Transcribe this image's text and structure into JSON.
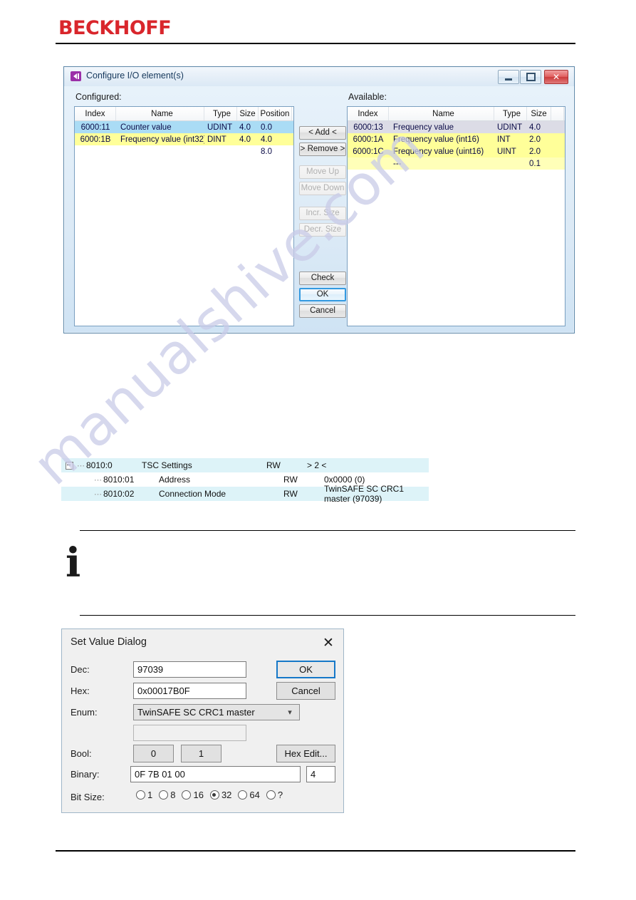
{
  "page": {
    "brand": "BECKHOFF",
    "watermark": "manualshive.com"
  },
  "io_dialog": {
    "title": "Configure I/O element(s)",
    "title_icon": "configure-io-icon",
    "window_buttons": {
      "minimize": "minimize-icon",
      "maximize": "maximize-icon",
      "close": "✕"
    },
    "configured": {
      "label": "Configured:",
      "columns": [
        "Index",
        "Name",
        "Type",
        "Size",
        "Position"
      ],
      "rows": [
        {
          "index": "6000:11",
          "name": "Counter value",
          "type": "UDINT",
          "size": "4.0",
          "position": "0.0",
          "style": "row-sel-blue"
        },
        {
          "index": "6000:1B",
          "name": "Frequency value (int32)",
          "type": "DINT",
          "size": "4.0",
          "position": "4.0",
          "style": "row-yellow"
        },
        {
          "index": "",
          "name": "",
          "type": "",
          "size": "",
          "position": "8.0",
          "style": "row-plain"
        }
      ]
    },
    "available": {
      "label": "Available:",
      "columns": [
        "Index",
        "Name",
        "Type",
        "Size"
      ],
      "rows": [
        {
          "index": "6000:13",
          "name": "Frequency value",
          "type": "UDINT",
          "size": "4.0",
          "style": "row-sel-grey"
        },
        {
          "index": "6000:1A",
          "name": "Frequency value (int16)",
          "type": "INT",
          "size": "2.0",
          "style": "row-yellow"
        },
        {
          "index": "6000:1C",
          "name": "Frequency value (uint16)",
          "type": "UINT",
          "size": "2.0",
          "style": "row-yellow"
        },
        {
          "index": "",
          "name": "---",
          "type": "",
          "size": "0.1",
          "style": "row-yellow-l"
        }
      ]
    },
    "buttons": {
      "add": "< Add <",
      "remove": "> Remove >",
      "move_up": "Move Up",
      "move_down": "Move Down",
      "incr_size": "Incr. Size",
      "decr_size": "Decr. Size",
      "check": "Check",
      "ok": "OK",
      "cancel": "Cancel"
    }
  },
  "coe_tree": {
    "rows": [
      {
        "index": "8010:0",
        "name": "TSC Settings",
        "flags": "RW",
        "value": "> 2 <"
      },
      {
        "index": "8010:01",
        "name": "Address",
        "flags": "RW",
        "value": "0x0000 (0)"
      },
      {
        "index": "8010:02",
        "name": "Connection Mode",
        "flags": "RW",
        "value": "TwinSAFE SC CRC1 master (97039)"
      }
    ]
  },
  "info_note": {
    "icon": "information-icon",
    "text": ""
  },
  "set_value_dialog": {
    "title": "Set Value Dialog",
    "close": "✕",
    "fields": {
      "dec_label": "Dec:",
      "dec_value": "97039",
      "hex_label": "Hex:",
      "hex_value": "0x00017B0F",
      "enum_label": "Enum:",
      "enum_value": "TwinSAFE SC CRC1 master",
      "extra_value": "",
      "bool_label": "Bool:",
      "bool_zero": "0",
      "bool_one": "1",
      "binary_label": "Binary:",
      "binary_value": "0F 7B 01 00",
      "binary_len": "4",
      "bitsize_label": "Bit Size:"
    },
    "buttons": {
      "ok": "OK",
      "cancel": "Cancel",
      "hex_edit": "Hex Edit..."
    },
    "bit_sizes": [
      {
        "label": "1",
        "checked": false
      },
      {
        "label": "8",
        "checked": false
      },
      {
        "label": "16",
        "checked": false
      },
      {
        "label": "32",
        "checked": true
      },
      {
        "label": "64",
        "checked": false
      },
      {
        "label": "?",
        "checked": false
      }
    ]
  },
  "colors": {
    "brand_red": "#d9262c",
    "selection_blue": "#aadcf5",
    "highlight_yellow": "#ffff99",
    "tree_highlight": "#ddf3f8",
    "focus_blue": "#1678c8"
  }
}
